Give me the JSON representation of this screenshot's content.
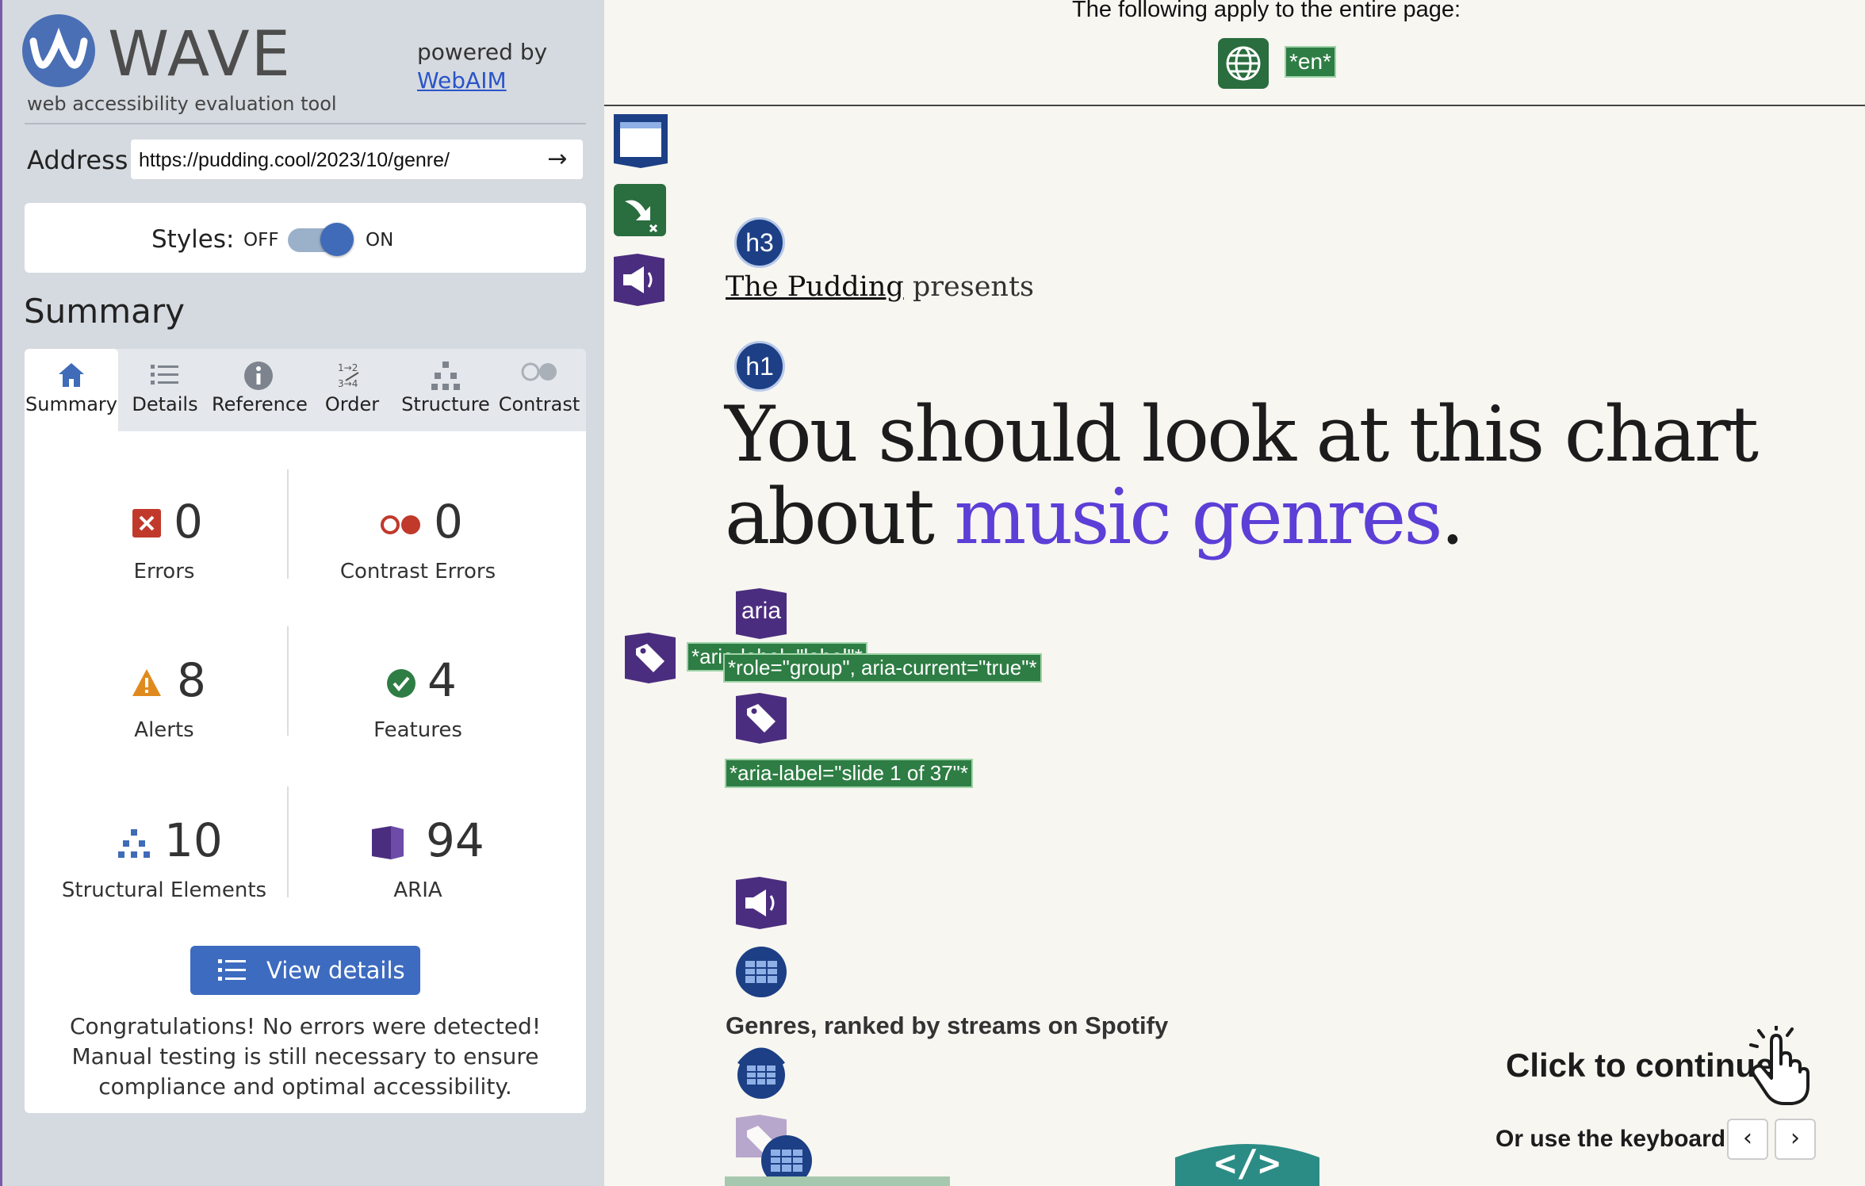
{
  "sidebar": {
    "logo_text": "WAVE",
    "tagline": "web accessibility evaluation tool",
    "powered_by": "powered by",
    "webaim_link": "WebAIM",
    "address_label": "Address:",
    "address_value": "https://pudding.cool/2023/10/genre/",
    "styles_label": "Styles:",
    "styles_off": "OFF",
    "styles_on": "ON",
    "summary_heading": "Summary",
    "tabs": [
      {
        "label": "Summary",
        "icon": "home-icon"
      },
      {
        "label": "Details",
        "icon": "list-icon"
      },
      {
        "label": "Reference",
        "icon": "info-icon"
      },
      {
        "label": "Order",
        "icon": "order-icon"
      },
      {
        "label": "Structure",
        "icon": "structure-icon"
      },
      {
        "label": "Contrast",
        "icon": "contrast-icon"
      }
    ],
    "stats": {
      "errors": {
        "value": "0",
        "label": "Errors"
      },
      "contrast_errors": {
        "value": "0",
        "label": "Contrast Errors"
      },
      "alerts": {
        "value": "8",
        "label": "Alerts"
      },
      "features": {
        "value": "4",
        "label": "Features"
      },
      "structural": {
        "value": "10",
        "label": "Structural Elements"
      },
      "aria": {
        "value": "94",
        "label": "ARIA"
      }
    },
    "view_details": "View details ›",
    "congrats": "Congratulations! No errors were detected! Manual testing is still necessary to ensure compliance and optimal accessibility."
  },
  "page": {
    "apply_text": "The following apply to the entire page:",
    "lang_badge": "*en*",
    "h3_badge": "h3",
    "h1_badge": "h1",
    "aria_badge": "aria",
    "brand": "The Pudding",
    "presents": "presents",
    "headline_main": "You should look at this chart about",
    "headline_accent": "music genres",
    "headline_period": ".",
    "label_aria_partial": "*aria-label=\"label\"*",
    "label_role_group": "*role=\"group\", aria-current=\"true\"*",
    "label_slide": "*aria-label=\"slide 1 of 37\"*",
    "genres_title": "Genres, ranked by streams on Spotify",
    "click_continue": "Click to continue",
    "keyboard_text": "Or use the keyboard",
    "key_prev": "‹",
    "key_next": "›",
    "code_badge": "</>"
  },
  "colors": {
    "wave_blue": "#4a6fb5",
    "accent_purple": "#5b3fd6",
    "aria_purple": "#4b2d7f",
    "feature_green": "#2e7d44",
    "error_red": "#c0392b",
    "alert_orange": "#e08a1e"
  }
}
